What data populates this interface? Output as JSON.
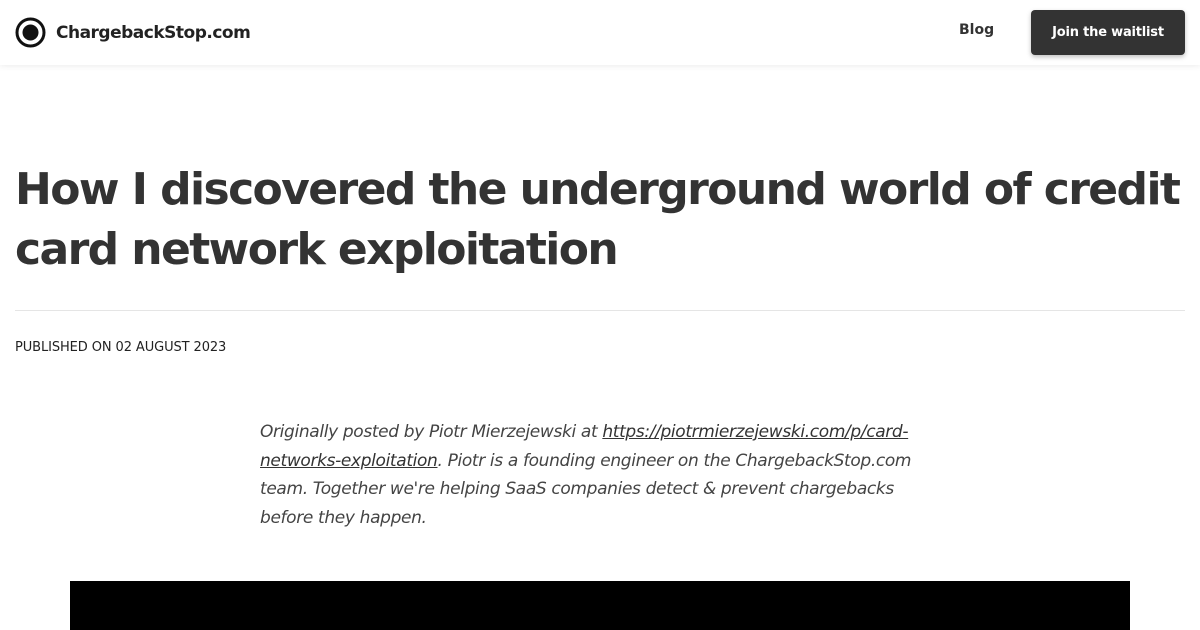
{
  "header": {
    "brand_name": "ChargebackStop.com",
    "logo_icon": "circle-target-icon",
    "nav_blog": "Blog",
    "cta_label": "Join the waitlist"
  },
  "article": {
    "title": "How I discovered the underground world of credit card network exploitation",
    "published": "PUBLISHED ON 02 AUGUST 2023",
    "intro_before": "Originally posted by Piotr Mierzejewski at ",
    "intro_link": "https://piotrmierzejewski.com/p/card-networks-exploitation",
    "intro_after": ". Piotr is a founding engineer on the ChargebackStop.com team. Together we're helping SaaS companies detect & prevent chargebacks before they happen."
  },
  "colors": {
    "text": "#333333",
    "cta_background": "#333333",
    "cta_text": "#ffffff",
    "divider": "#e5e5e5",
    "hero_image": "#000000"
  }
}
